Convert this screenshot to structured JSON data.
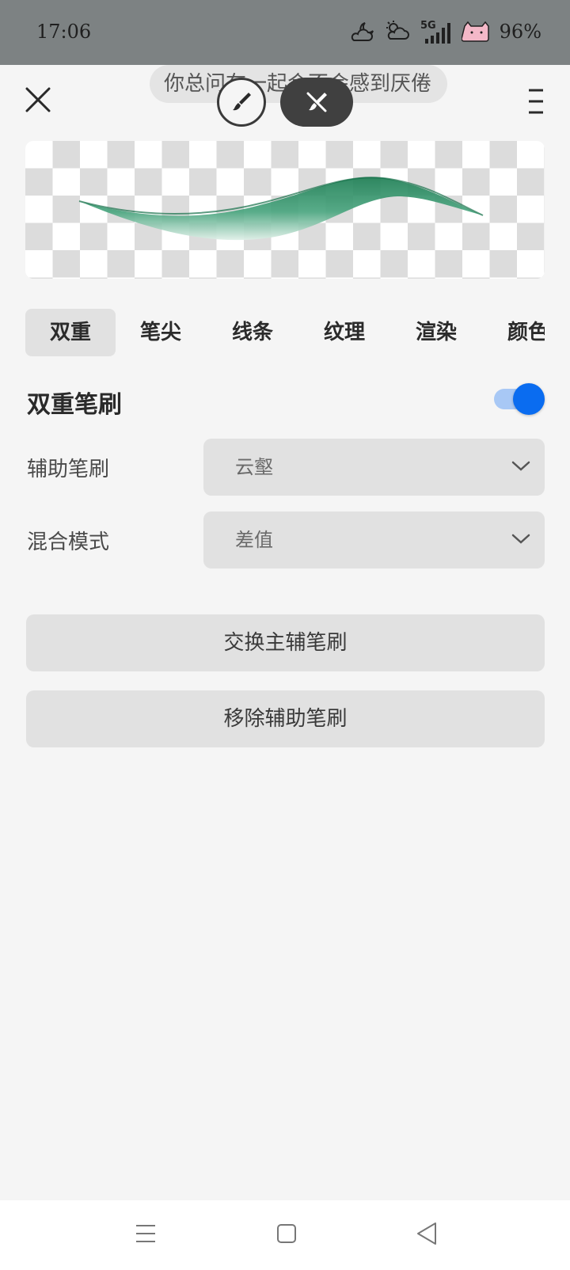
{
  "status_bar": {
    "time": "17:06",
    "network": "5G",
    "battery": "96%",
    "icons": [
      "cloudy-night-icon",
      "cloudy-sun-icon",
      "signal-5g-icon",
      "battery-cat-icon"
    ]
  },
  "header": {
    "toast_text": "你总问在一起会不会感到厌倦",
    "close_icon": "close-icon",
    "menu_icon": "menu-icon",
    "brush_mode_icon": "brush-icon",
    "eraser_mode_icon": "eraser-icon"
  },
  "preview": {
    "stroke_color": "#2f8a64"
  },
  "tabs": [
    {
      "label": "双重",
      "active": true
    },
    {
      "label": "笔尖",
      "active": false
    },
    {
      "label": "线条",
      "active": false
    },
    {
      "label": "纹理",
      "active": false
    },
    {
      "label": "渲染",
      "active": false
    },
    {
      "label": "颜色",
      "active": false
    }
  ],
  "dual_brush": {
    "title": "双重笔刷",
    "enabled": true,
    "accent": "#0a6cf0",
    "secondary_brush": {
      "label": "辅助笔刷",
      "value": "云壑"
    },
    "blend_mode": {
      "label": "混合模式",
      "value": "差值"
    },
    "swap_button": "交换主辅笔刷",
    "remove_button": "移除辅助笔刷"
  },
  "nav_bar": {
    "icons": [
      "menu-lines-icon",
      "home-square-icon",
      "back-triangle-icon"
    ]
  }
}
